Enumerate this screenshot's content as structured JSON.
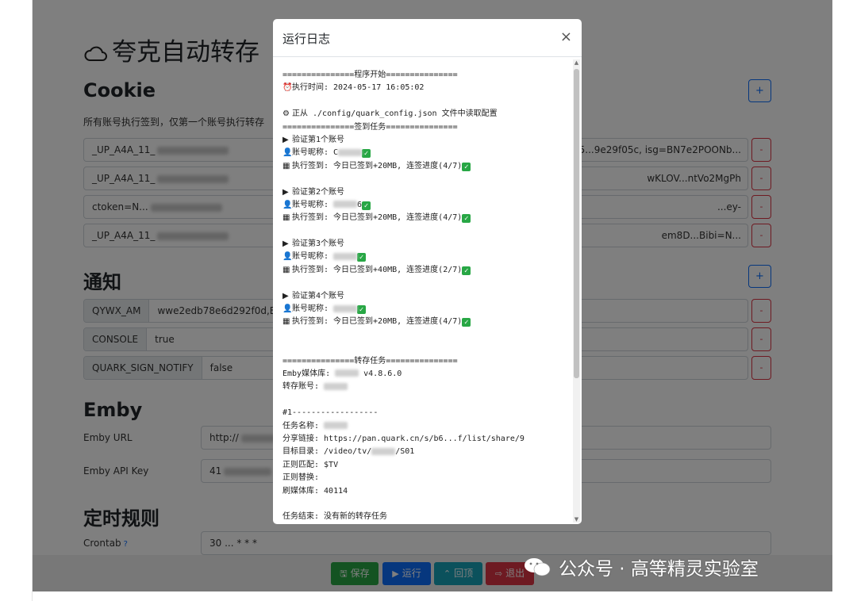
{
  "app": {
    "title": "夸克自动转存"
  },
  "cookie": {
    "heading": "Cookie",
    "hint": "所有账号执行签到，仅第一个账号执行转存",
    "add_label": "+",
    "remove_label": "-",
    "rows": [
      {
        "left": "_UP_A4A_11_",
        "right": "-85...9e29f05c, isg=BN7e2POONb..."
      },
      {
        "left": "_UP_A4A_11_",
        "right": "wKLOV...ntVo2MgPh"
      },
      {
        "left": "ctoken=N...",
        "right": "...ey-"
      },
      {
        "left": "_UP_A4A_11_",
        "right": "em8D...Bibi=N..."
      }
    ]
  },
  "notify": {
    "heading": "通知",
    "add_label": "+",
    "remove_label": "-",
    "rows": [
      {
        "key": "QYWX_AM",
        "value": "wwe2edb78e6d292f0d,BzrU..."
      },
      {
        "key": "CONSOLE",
        "value": "true"
      },
      {
        "key": "QUARK_SIGN_NOTIFY",
        "value": "false"
      }
    ]
  },
  "emby": {
    "heading": "Emby",
    "url_label": "Emby URL",
    "url_value": "http://",
    "key_label": "Emby API Key",
    "key_value": "41"
  },
  "cron": {
    "heading": "定时规则",
    "label": "Crontab",
    "help": "?",
    "value": "30 ... * * *"
  },
  "footer": {
    "save": "保存",
    "run": "运行",
    "top": "回顶",
    "logout": "退出",
    "colors": {
      "save": "#28a745",
      "run": "#0d6efd",
      "top": "#17a2b8",
      "logout": "#dc3545"
    }
  },
  "modal": {
    "title": "运行日志",
    "close": "×",
    "lines": [
      {
        "icon": "",
        "text": "===============程序开始==============="
      },
      {
        "icon": "⏰",
        "text": "执行时间: 2024-05-17 16:05:02"
      },
      {
        "icon": "",
        "text": ""
      },
      {
        "icon": "⚙",
        "text": "正从 ./config/quark_config.json 文件中读取配置"
      },
      {
        "icon": "",
        "text": "===============签到任务==============="
      },
      {
        "icon": "▶",
        "text": "验证第1个账号"
      },
      {
        "icon": "👤",
        "text": "账号昵称: C",
        "mask": true,
        "ok": true
      },
      {
        "icon": "▦",
        "text": "执行签到: 今日已签到+20MB, 连签进度(4/7)",
        "ok": true
      },
      {
        "icon": "",
        "text": ""
      },
      {
        "icon": "▶",
        "text": "验证第2个账号"
      },
      {
        "icon": "👤",
        "text": "账号昵称: ",
        "mask": true,
        "tail": "6",
        "ok": true
      },
      {
        "icon": "▦",
        "text": "执行签到: 今日已签到+20MB, 连签进度(4/7)",
        "ok": true
      },
      {
        "icon": "",
        "text": ""
      },
      {
        "icon": "▶",
        "text": "验证第3个账号"
      },
      {
        "icon": "👤",
        "text": "账号昵称: ",
        "mask": true,
        "ok": true
      },
      {
        "icon": "▦",
        "text": "执行签到: 今日已签到+40MB, 连签进度(2/7)",
        "ok": true
      },
      {
        "icon": "",
        "text": ""
      },
      {
        "icon": "▶",
        "text": "验证第4个账号"
      },
      {
        "icon": "👤",
        "text": "账号昵称: ",
        "mask": true,
        "ok": true
      },
      {
        "icon": "▦",
        "text": "执行签到: 今日已签到+20MB, 连签进度(4/7)",
        "ok": true
      },
      {
        "icon": "",
        "text": ""
      },
      {
        "icon": "",
        "text": ""
      },
      {
        "icon": "",
        "text": "===============转存任务==============="
      },
      {
        "text": "Emby媒体库: ",
        "mask": true,
        "tail": " v4.8.6.0"
      },
      {
        "text": "转存账号: ",
        "mask": true
      },
      {
        "text": ""
      },
      {
        "text": "#1------------------"
      },
      {
        "text": "任务名称: ",
        "mask": true
      },
      {
        "text": "分享链接: https://pan.quark.cn/s/b6...f/list/share/9"
      },
      {
        "text": "目标目录: /video/tv/",
        "mask": true,
        "tail": "/S01"
      },
      {
        "text": "正则匹配: $TV"
      },
      {
        "text": "正则替换: "
      },
      {
        "text": "刷媒体库: 40114"
      },
      {
        "text": ""
      },
      {
        "text": "任务结束: 没有新的转存任务"
      }
    ]
  },
  "watermark": {
    "text": "公众号 · 高等精灵实验室"
  }
}
